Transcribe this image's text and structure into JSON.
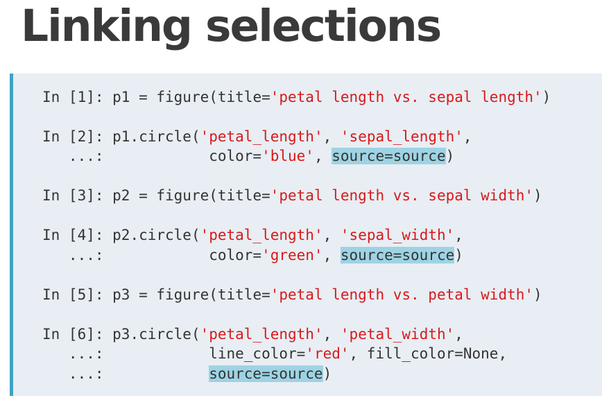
{
  "slide": {
    "title": "Linking selections",
    "colors": {
      "panel_background": "#e8eef3",
      "panel_border": "#3ea3c4",
      "code_text": "#333333",
      "string_text": "#d7191c",
      "highlight": "#9ed3e4"
    }
  },
  "code": {
    "cell1": {
      "prompt": "In [1]: ",
      "a": "p1 = figure(title=",
      "s1": "'petal length vs. sepal length'",
      "b": ")"
    },
    "cell2": {
      "prompt": "In [2]: ",
      "a": "p1.circle(",
      "s1": "'petal_length'",
      "sep": ", ",
      "s2": "'sepal_length'",
      "b": ",",
      "cont": "   ...:            ",
      "c": "color=",
      "s3": "'blue'",
      "d": ", ",
      "hl": "source=source",
      "e": ")"
    },
    "cell3": {
      "prompt": "In [3]: ",
      "a": "p2 = figure(title=",
      "s1": "'petal length vs. sepal width'",
      "b": ")"
    },
    "cell4": {
      "prompt": "In [4]: ",
      "a": "p2.circle(",
      "s1": "'petal_length'",
      "sep": ", ",
      "s2": "'sepal_width'",
      "b": ",",
      "cont": "   ...:            ",
      "c": "color=",
      "s3": "'green'",
      "d": ", ",
      "hl": "source=source",
      "e": ")"
    },
    "cell5": {
      "prompt": "In [5]: ",
      "a": "p3 = figure(title=",
      "s1": "'petal length vs. petal width'",
      "b": ")"
    },
    "cell6": {
      "prompt": "In [6]: ",
      "a": "p3.circle(",
      "s1": "'petal_length'",
      "sep": ", ",
      "s2": "'petal_width'",
      "b": ",",
      "cont": "   ...:            ",
      "c": "line_color=",
      "s3": "'red'",
      "d": ", fill_color=None,",
      "cont2": "   ...:            ",
      "hl": "source=source",
      "e": ")"
    }
  }
}
